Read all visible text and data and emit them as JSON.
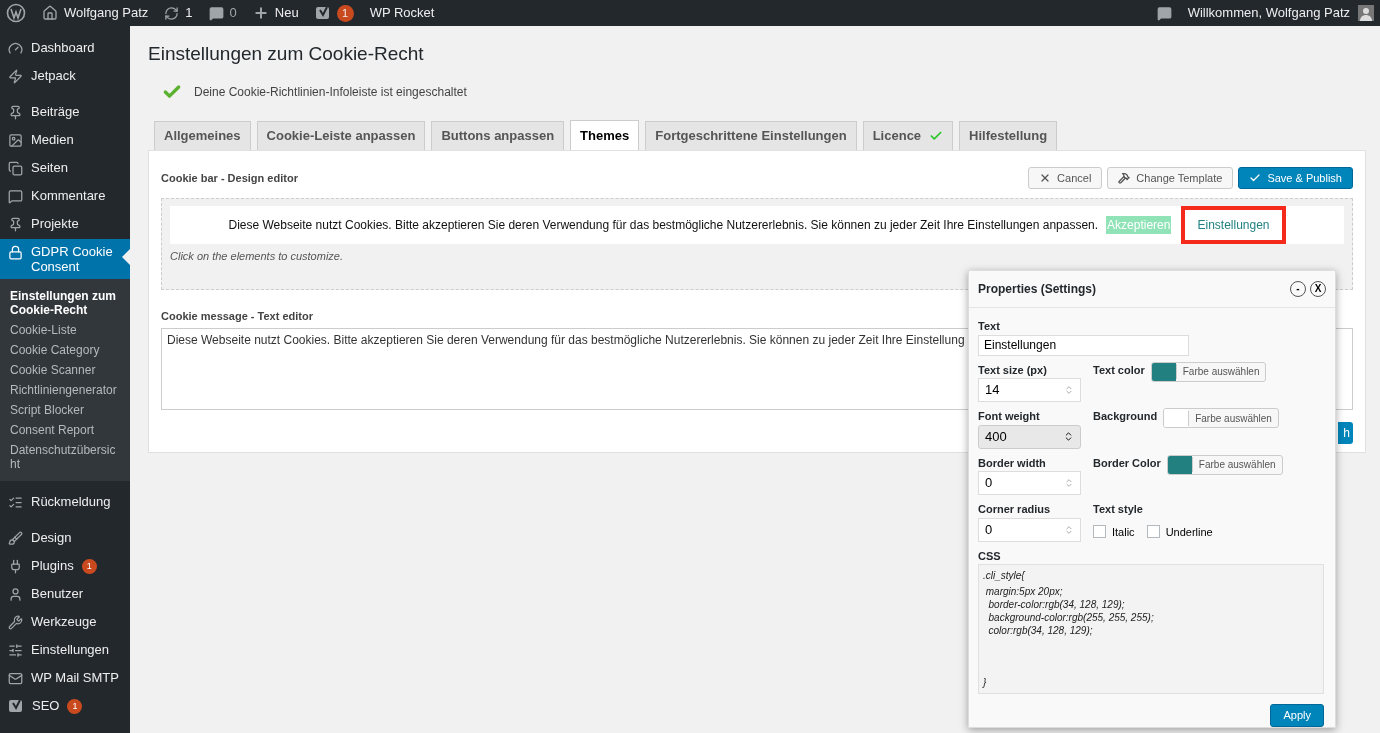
{
  "admin_bar": {
    "items": [
      {
        "kind": "logo"
      },
      {
        "kind": "home",
        "label": "Wolfgang Patz"
      },
      {
        "kind": "updates",
        "label": "1"
      },
      {
        "kind": "comments",
        "label": "0"
      },
      {
        "kind": "new",
        "label": "Neu"
      },
      {
        "kind": "seo",
        "badge": "1"
      },
      {
        "kind": "text",
        "label": "WP Rocket"
      }
    ],
    "greeting": "Willkommen, Wolfgang Patz"
  },
  "sidebar": {
    "groups": [
      {
        "items": [
          {
            "label": "Dashboard",
            "selected": false
          },
          {
            "label": "Jetpack",
            "selected": false
          }
        ]
      },
      {
        "items": [
          {
            "label": "Beiträge",
            "selected": false
          },
          {
            "label": "Medien",
            "selected": false
          },
          {
            "label": "Seiten",
            "selected": false
          },
          {
            "label": "Kommentare",
            "selected": false
          },
          {
            "label": "Projekte",
            "selected": false
          },
          {
            "label": "GDPR Cookie Consent",
            "selected": true,
            "children": [
              {
                "label": "Einstellungen zum Cookie-Recht",
                "selected": true
              },
              {
                "label": "Cookie-Liste",
                "selected": false
              },
              {
                "label": "Cookie Category",
                "selected": false
              },
              {
                "label": "Cookie Scanner",
                "selected": false
              },
              {
                "label": "Richtliniengenerator",
                "selected": false
              },
              {
                "label": "Script Blocker",
                "selected": false
              },
              {
                "label": "Consent Report",
                "selected": false
              },
              {
                "label": "Datenschutzübersicht",
                "selected": false
              }
            ]
          }
        ]
      },
      {
        "items": [
          {
            "label": "Rückmeldung",
            "selected": false
          }
        ]
      },
      {
        "items": [
          {
            "label": "Design",
            "selected": false
          },
          {
            "label": "Plugins",
            "selected": false,
            "badge": "1"
          },
          {
            "label": "Benutzer",
            "selected": false
          },
          {
            "label": "Werkzeuge",
            "selected": false
          },
          {
            "label": "Einstellungen",
            "selected": false
          },
          {
            "label": "WP Mail SMTP",
            "selected": false
          },
          {
            "label": "SEO",
            "selected": false,
            "badge": "1"
          }
        ]
      }
    ]
  },
  "page": {
    "title": "Einstellungen zum Cookie-Recht",
    "notice": "Deine Cookie-Richtlinien-Infoleiste ist eingeschaltet",
    "tabs": [
      {
        "label": "Allgemeines",
        "selected": false,
        "checked": false
      },
      {
        "label": "Cookie-Leiste anpassen",
        "selected": false,
        "checked": false
      },
      {
        "label": "Buttons anpassen",
        "selected": false,
        "checked": false
      },
      {
        "label": "Themes",
        "selected": true,
        "checked": false
      },
      {
        "label": "Fortgeschrittene Einstellungen",
        "selected": false,
        "checked": false
      },
      {
        "label": "Licence",
        "selected": false,
        "checked": true
      },
      {
        "label": "Hilfestellung",
        "selected": false,
        "checked": false
      }
    ]
  },
  "design_editor": {
    "heading": "Cookie bar - Design editor",
    "buttons": [
      {
        "kind": "cancel",
        "label": "Cancel"
      },
      {
        "kind": "template",
        "label": "Change Template"
      },
      {
        "kind": "publish",
        "label": "Save & Publish"
      }
    ],
    "preview": {
      "message": "Diese Webseite nutzt Cookies. Bitte akzeptieren Sie deren Verwendung für das bestmögliche Nutzererlebnis. Sie können zu jeder Zeit Ihre Einstellungen anpassen.",
      "accept": {
        "label": "Akzeptieren",
        "selected": false
      },
      "settings": {
        "label": "Einstellungen",
        "selected": true
      }
    },
    "hint": "Click on the elements to customize."
  },
  "text_editor": {
    "heading": "Cookie message - Text editor",
    "value": "Diese Webseite nutzt Cookies. Bitte akzeptieren Sie deren Verwendung für das bestmögliche Nutzererlebnis. Sie können zu jeder Zeit Ihre Einstellung",
    "button_fragment": "h"
  },
  "properties": {
    "title": "Properties (Settings)",
    "minimize": "-",
    "close": "X",
    "text": {
      "label": "Text",
      "value": "Einstellungen"
    },
    "text_size": {
      "label": "Text size (px)",
      "value": "14"
    },
    "text_color": {
      "label": "Text color",
      "color": "#228081",
      "button": "Farbe auswählen"
    },
    "font_weight": {
      "label": "Font weight",
      "value": "400"
    },
    "background": {
      "label": "Background",
      "color": "#ffffff",
      "button": "Farbe auswählen"
    },
    "border_width": {
      "label": "Border width",
      "value": "0"
    },
    "border_color": {
      "label": "Border Color",
      "color": "#228081",
      "button": "Farbe auswählen"
    },
    "corner_radius": {
      "label": "Corner radius",
      "value": "0"
    },
    "text_style": {
      "label": "Text style",
      "options": [
        {
          "label": "Italic",
          "checked": false
        },
        {
          "label": "Underline",
          "checked": false
        }
      ]
    },
    "css": {
      "label": "CSS",
      "lines": [
        ".cli_style{",
        " margin:5px 20px;",
        "  border-color:rgb(34, 128, 129);",
        "  background-color:rgb(255, 255, 255);",
        "  color:rgb(34, 128, 129);",
        "}"
      ]
    },
    "apply": "Apply"
  }
}
